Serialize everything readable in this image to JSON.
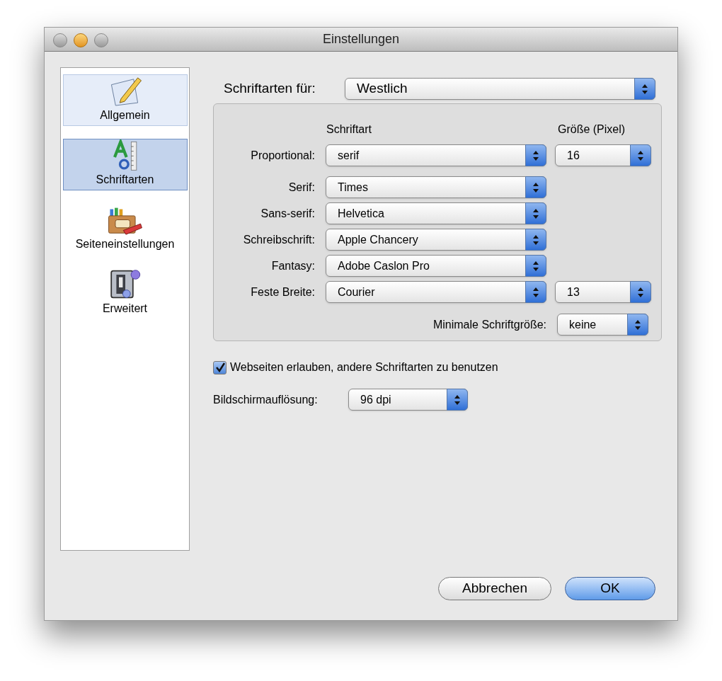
{
  "window": {
    "title": "Einstellungen"
  },
  "sidebar": {
    "items": [
      {
        "label": "Allgemein",
        "kind": "pencil",
        "selected": false,
        "highlighted": true
      },
      {
        "label": "Schriftarten",
        "kind": "font",
        "selected": true,
        "highlighted": false
      },
      {
        "label": "Seiteneinstellungen",
        "kind": "crayons",
        "selected": false,
        "highlighted": false
      },
      {
        "label": "Erweitert",
        "kind": "switch",
        "selected": false,
        "highlighted": false
      }
    ]
  },
  "fonts_for": {
    "label": "Schriftarten für:",
    "value": "Westlich"
  },
  "group": {
    "column_headers": [
      "Schriftart",
      "Größe (Pixel)"
    ],
    "rows": [
      {
        "label": "Proportional:",
        "font": "serif",
        "size": "16"
      },
      {
        "label": "Serif:",
        "font": "Times"
      },
      {
        "label": "Sans-serif:",
        "font": "Helvetica"
      },
      {
        "label": "Schreibschrift:",
        "font": "Apple Chancery"
      },
      {
        "label": "Fantasy:",
        "font": "Adobe Caslon Pro"
      },
      {
        "label": "Feste Breite:",
        "font": "Courier",
        "size": "13"
      }
    ],
    "minimum": {
      "label": "Minimale Schriftgröße:",
      "value": "keine"
    }
  },
  "allow_fonts": {
    "label": "Webseiten erlauben, andere Schriftarten zu benutzen",
    "checked": true
  },
  "resolution": {
    "label": "Bildschirmauflösung:",
    "value": "96 dpi"
  },
  "buttons": [
    {
      "label": "Abbrechen",
      "kind": "cancel"
    },
    {
      "label": "OK",
      "kind": "default"
    }
  ]
}
